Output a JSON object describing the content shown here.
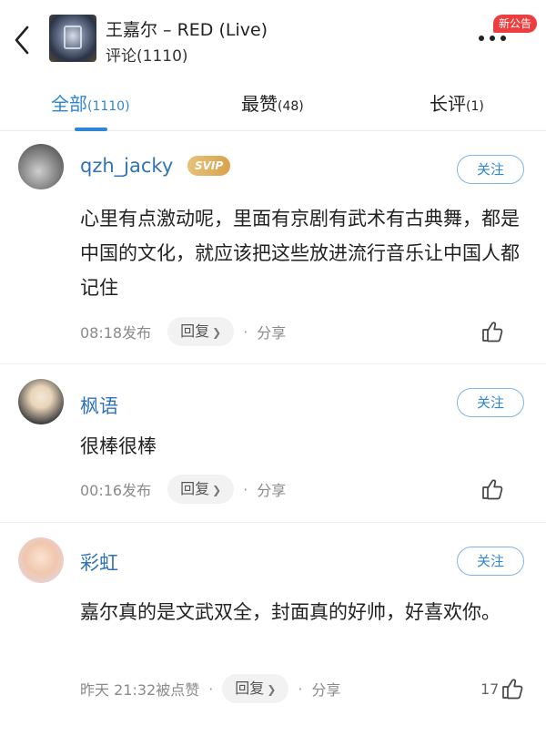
{
  "header": {
    "song_title": "王嘉尔 – RED (Live)",
    "comment_count_title": "评论(1110)",
    "notice_badge": "新公告"
  },
  "tabs": [
    {
      "label": "全部",
      "count": "(1110)",
      "active": true
    },
    {
      "label": "最赞",
      "count": "(48)",
      "active": false
    },
    {
      "label": "长评",
      "count": "(1)",
      "active": false
    }
  ],
  "comments": [
    {
      "username": "qzh_jacky",
      "badge": "SVIP",
      "follow_label": "关注",
      "text": "心里有点激动呢，里面有京剧有武术有古典舞，都是中国的文化，就应该把这些放进流行音乐让中国人都记住",
      "time": "08:18发布",
      "reply_label": "回复",
      "share_label": "分享",
      "likes": ""
    },
    {
      "username": "枫语",
      "follow_label": "关注",
      "text": "很棒很棒",
      "time": "00:16发布",
      "reply_label": "回复",
      "share_label": "分享",
      "likes": ""
    },
    {
      "username": "彩虹",
      "follow_label": "关注",
      "text": "嘉尔真的是文武双全，封面真的好帅，好喜欢你。",
      "time": "昨天 21:32被点赞",
      "reply_label": "回复",
      "share_label": "分享",
      "likes": "17"
    }
  ]
}
